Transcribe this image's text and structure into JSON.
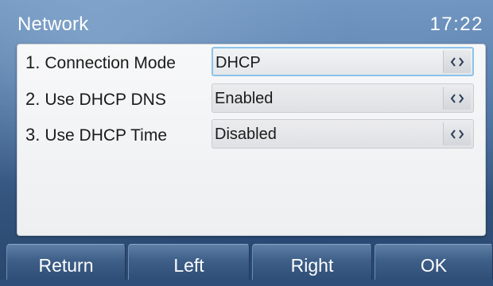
{
  "header": {
    "title": "Network",
    "time": "17:22"
  },
  "settings": [
    {
      "number": "1.",
      "label": "Connection Mode",
      "value": "DHCP"
    },
    {
      "number": "2.",
      "label": "Use DHCP DNS",
      "value": "Enabled"
    },
    {
      "number": "3.",
      "label": "Use DHCP Time",
      "value": "Disabled"
    }
  ],
  "softkeys": {
    "return": "Return",
    "left": "Left",
    "right": "Right",
    "ok": "OK"
  },
  "colors": {
    "focus_border": "#8bc3ea",
    "background_blue": "#4b6f9c"
  }
}
